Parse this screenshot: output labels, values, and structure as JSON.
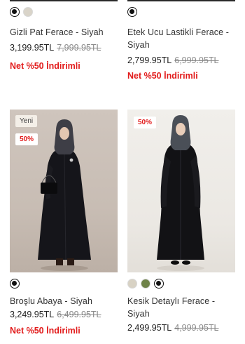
{
  "products": [
    {
      "name": "Gizli Pat Ferace - Siyah",
      "price": "3,199.95TL",
      "old_price": "7,999.95TL",
      "promo": "Net %50 İndirimli",
      "swatches": [
        {
          "color": "#111111",
          "selected": true
        },
        {
          "color": "#d9d4c9",
          "selected": false
        }
      ]
    },
    {
      "name": "Etek Ucu Lastikli Ferace - Siyah",
      "price": "2,799.95TL",
      "old_price": "6,999.95TL",
      "promo": "Net %50 İndirimli",
      "swatches": [
        {
          "color": "#111111",
          "selected": true
        }
      ]
    },
    {
      "name": "Broşlu Abaya - Siyah",
      "price": "3,249.95TL",
      "old_price": "6,499.95TL",
      "promo": "Net %50 İndirimli",
      "badges": {
        "new": "Yeni",
        "sale": "50%"
      },
      "swatches": [
        {
          "color": "#111111",
          "selected": true
        }
      ]
    },
    {
      "name": "Kesik Detaylı Ferace - Siyah",
      "price": "2,499.95TL",
      "old_price": "4,999.95TL",
      "badges": {
        "sale": "50%"
      },
      "swatches": [
        {
          "color": "#d8d2c4",
          "selected": false
        },
        {
          "color": "#6e8248",
          "selected": false
        },
        {
          "color": "#111111",
          "selected": true
        }
      ]
    }
  ],
  "colors": {
    "promo": "#e21b1b",
    "old_price": "#8a8a8a"
  }
}
